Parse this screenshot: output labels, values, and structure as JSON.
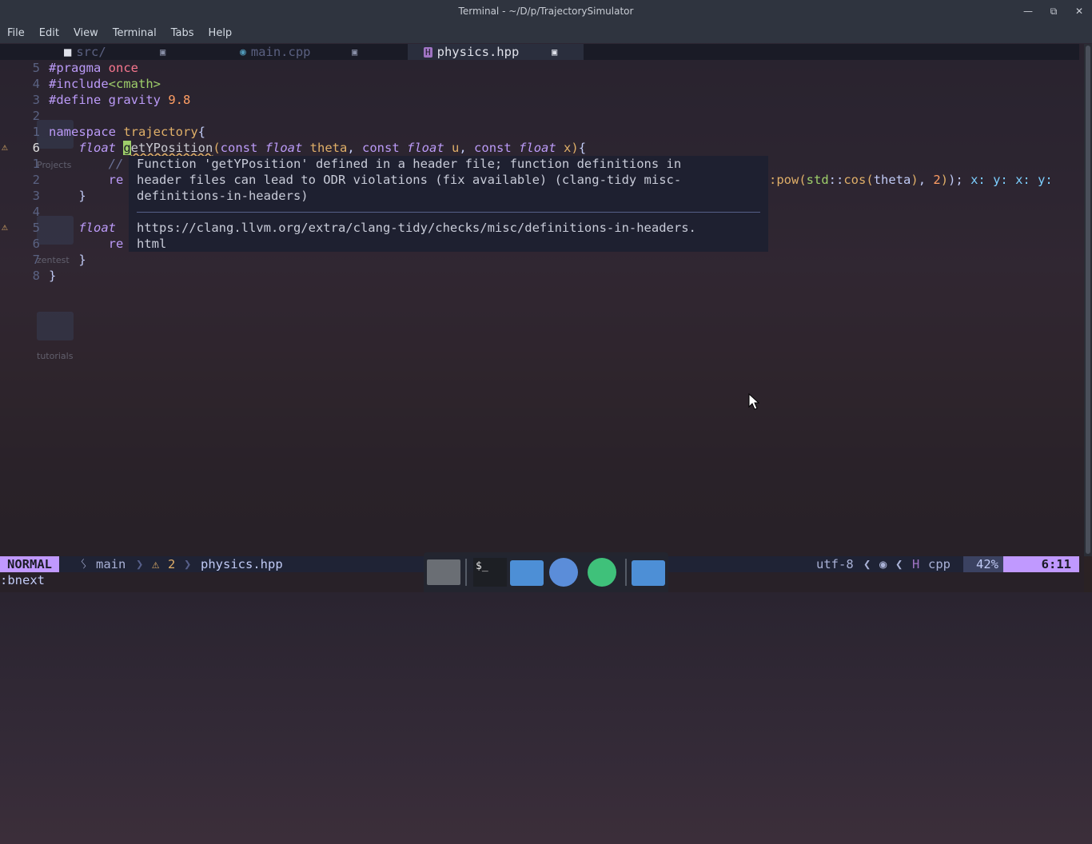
{
  "window": {
    "title": "Terminal - ~/D/p/TrajectorySimulator",
    "minimize": "—",
    "maximize": "⧉",
    "close": "✕"
  },
  "menu": [
    "File",
    "Edit",
    "View",
    "Terminal",
    "Tabs",
    "Help"
  ],
  "tabs": [
    {
      "label": "src/",
      "icon": "folder-icon"
    },
    {
      "label": "main.cpp",
      "icon": "cpp-file-icon"
    },
    {
      "label": "physics.hpp",
      "icon": "header-file-icon",
      "active": true
    }
  ],
  "lines": [
    {
      "num": "5",
      "tokens": [
        [
          "pp",
          "#pragma "
        ],
        [
          "once",
          "once"
        ]
      ]
    },
    {
      "num": "4",
      "tokens": [
        [
          "pp",
          "#include"
        ],
        [
          "inc",
          "<cmath>"
        ]
      ]
    },
    {
      "num": "3",
      "tokens": [
        [
          "pp",
          "#define "
        ],
        [
          "kw",
          "gravity "
        ],
        [
          "num",
          "9.8"
        ]
      ]
    },
    {
      "num": "2",
      "tokens": []
    },
    {
      "num": "1",
      "tokens": [
        [
          "ns",
          "namespace "
        ],
        [
          "nsname",
          "trajectory"
        ],
        [
          "brace",
          "{"
        ]
      ]
    },
    {
      "num": "6",
      "sign": "⚠",
      "cur": true,
      "tokens": [
        [
          "punc",
          "    "
        ],
        [
          "ty",
          "float "
        ],
        [
          "cursor",
          "g"
        ],
        [
          "squig",
          "etYPosition"
        ],
        [
          "par",
          "("
        ],
        [
          "kw",
          "const "
        ],
        [
          "ty",
          "float "
        ],
        [
          "id",
          "theta"
        ],
        [
          "punc",
          ", "
        ],
        [
          "kw",
          "const "
        ],
        [
          "ty",
          "float "
        ],
        [
          "id",
          "u"
        ],
        [
          "punc",
          ", "
        ],
        [
          "kw",
          "const "
        ],
        [
          "ty",
          "float "
        ],
        [
          "id",
          "x"
        ],
        [
          "par",
          ")"
        ],
        [
          "brace",
          "{"
        ]
      ]
    },
    {
      "num": "1",
      "tokens": [
        [
          "cmt",
          "        //"
        ]
      ]
    },
    {
      "num": "2",
      "tokens": [
        [
          "kw",
          "        re"
        ]
      ]
    },
    {
      "num": "3",
      "tokens": [
        [
          "brace",
          "    }"
        ]
      ]
    },
    {
      "num": "4",
      "tokens": []
    },
    {
      "num": "5",
      "sign": "⚠",
      "tokens": [
        [
          "punc",
          "    "
        ],
        [
          "ty",
          "float"
        ]
      ]
    },
    {
      "num": "6",
      "tokens": [
        [
          "kw",
          "        re"
        ]
      ]
    },
    {
      "num": "7",
      "tokens": [
        [
          "brace",
          "    }"
        ]
      ]
    },
    {
      "num": "8",
      "tokens": [
        [
          "brace",
          "}"
        ]
      ]
    }
  ],
  "line2_tail": [
    [
      "fn",
      ":pow"
    ],
    [
      "par",
      "("
    ],
    [
      "inc",
      "std"
    ],
    [
      "punc",
      "::"
    ],
    [
      "fn",
      "cos"
    ],
    [
      "par",
      "("
    ],
    [
      "punc",
      "theta"
    ],
    [
      "par",
      ")"
    ],
    [
      "punc",
      ", "
    ],
    [
      "num",
      "2"
    ],
    [
      "par",
      ")"
    ],
    [
      "punc",
      ")"
    ],
    [
      "punc",
      "; "
    ],
    [
      "hint",
      "x: "
    ],
    [
      "hint",
      "y: "
    ],
    [
      "hint",
      "x: "
    ],
    [
      "hint",
      "y:"
    ]
  ],
  "hover": {
    "message": "Function 'getYPosition' defined in a header file; function definitions in\nheader files can lead to ODR violations (fix available) (clang-tidy misc-\ndefinitions-in-headers)",
    "url": "https://clang.llvm.org/extra/clang-tidy/checks/misc/definitions-in-headers.\nhtml"
  },
  "desktop_icons": [
    "Projects",
    "zentest",
    "tutorials"
  ],
  "status": {
    "mode": "NORMAL",
    "branch": "main",
    "warnings": "2",
    "file": "physics.hpp",
    "encoding": "utf-8",
    "filetype": "cpp",
    "percent": "42%",
    "position": "6:11"
  },
  "cmdline": ":bnext",
  "dock": [
    {
      "name": "workspace-switcher"
    },
    {
      "name": "terminal",
      "label": "$_"
    },
    {
      "name": "home-folder"
    },
    {
      "name": "web-browser"
    },
    {
      "name": "app-finder"
    },
    {
      "name": "file-manager"
    }
  ],
  "colors": {
    "mode_bg": "#c099ff",
    "warning": "#e0af68",
    "accent": "#bb9af7"
  }
}
